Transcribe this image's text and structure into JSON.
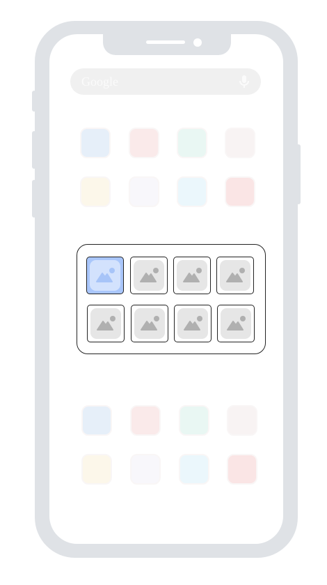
{
  "search": {
    "label": "Google",
    "icon": "mic-icon"
  },
  "apps_top": [
    {
      "name": "facebook",
      "color": "#cfe0f4"
    },
    {
      "name": "youtube",
      "color": "#f6d6d6"
    },
    {
      "name": "whatsapp",
      "color": "#d4f0e8"
    },
    {
      "name": "circle-app",
      "color": "#f3e9e9"
    },
    {
      "name": "notes",
      "color": "#fbf1d7"
    },
    {
      "name": "reddit",
      "color": "#f2f1f8"
    },
    {
      "name": "vimeo",
      "color": "#d8f0fa"
    },
    {
      "name": "clock",
      "color": "#f7cccc"
    }
  ],
  "apps_bottom": [
    {
      "name": "facebook",
      "color": "#cfe0f4"
    },
    {
      "name": "youtube",
      "color": "#f6d6d6"
    },
    {
      "name": "whatsapp",
      "color": "#d4f0e8"
    },
    {
      "name": "circle-app",
      "color": "#f3e9e9"
    },
    {
      "name": "notes",
      "color": "#fbf1d7"
    },
    {
      "name": "reddit",
      "color": "#f2f1f8"
    },
    {
      "name": "vimeo",
      "color": "#d8f0fa"
    },
    {
      "name": "clock",
      "color": "#f7cccc"
    }
  ],
  "picker": {
    "tile_count": 8,
    "selected_index": 0,
    "tile_icon": "image-placeholder-icon",
    "accent": "#a9c6fb"
  }
}
